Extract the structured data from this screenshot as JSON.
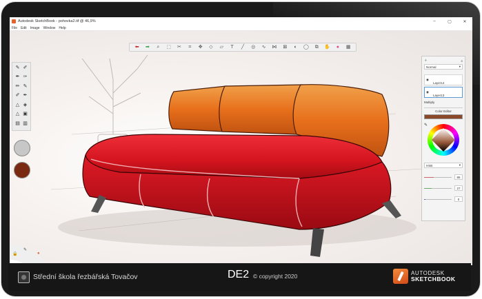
{
  "window": {
    "title": "Autodesk SketchBook - pohovka2.tif @ 46,9%",
    "controls": [
      "–",
      "▢",
      "✕"
    ]
  },
  "menu": [
    "File",
    "Edit",
    "Image",
    "Window",
    "Help"
  ],
  "toolbar_icons": [
    "undo-icon",
    "redo-icon",
    "zoom-icon",
    "select-icon",
    "lasso-icon",
    "crop-icon",
    "transform-icon",
    "distort-icon",
    "perspective-icon",
    "text-icon",
    "ruler-icon",
    "ellipse-icon",
    "french-curve-icon",
    "symmetry-icon",
    "perspective-grid-icon",
    "fill-icon",
    "shape-icon",
    "copy-icon",
    "brush-library-icon",
    "color-wheel-icon",
    "layers-icon"
  ],
  "brush_palette": {
    "tools": [
      "✎",
      "✐",
      "✒",
      "✑",
      "✏",
      "✎",
      "✐",
      "✒",
      "△",
      "◈",
      "△",
      "▣",
      "▤",
      "▥"
    ]
  },
  "colors": {
    "puck_top": "#c7c7c7",
    "puck_bottom": "#7a2a12",
    "editor_color": "#8a4a2a",
    "accent": "#e8622a"
  },
  "layers_panel": {
    "blend_mode": "Normal",
    "layers": [
      {
        "name": "Layer14"
      },
      {
        "name": "Layer13"
      }
    ],
    "multiply_label": "Multiply",
    "color_editor_title": "Color Editor",
    "mode_select": "HSB",
    "slider_values": [
      "86",
      "27",
      "0"
    ]
  },
  "footer": {
    "school": "Střední škola řezbářská Tovačov",
    "de2": "DE2",
    "copyright": "© copyright 2020",
    "brand_line1": "AUTODESK",
    "brand_line2": "SKETCHBOOK"
  }
}
